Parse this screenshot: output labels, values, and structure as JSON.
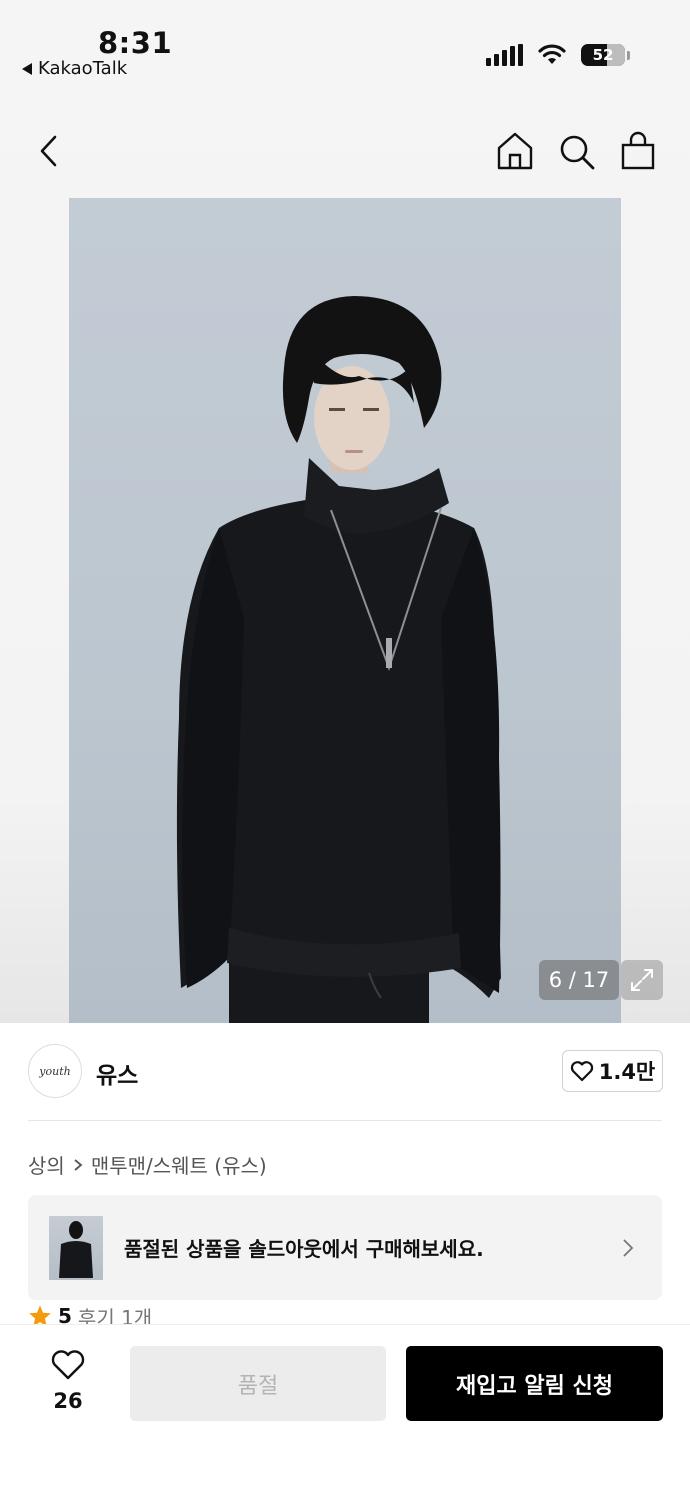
{
  "status_bar": {
    "time": "8:31",
    "back_app": "KakaoTalk",
    "battery": "52"
  },
  "nav": {
    "icons": [
      "back-icon",
      "home-icon",
      "search-icon",
      "shopping-bag-icon"
    ]
  },
  "gallery": {
    "counter": "6 / 17"
  },
  "brand": {
    "name": "유스",
    "logo_text": "youth",
    "likes": "1.4만"
  },
  "breadcrumb": {
    "category": "상의",
    "subcategory": "맨투맨/스웨트 (유스)"
  },
  "soldout_banner": {
    "text": "품절된 상품을 솔드아웃에서 구매해보세요."
  },
  "rating": {
    "score": "5",
    "reviews": "후기 1개"
  },
  "bottom_bar": {
    "wish_count": "26",
    "soldout_label": "품절",
    "restock_label": "재입고 알림 신청"
  },
  "colors": {
    "accent": "#000000",
    "star": "#f39b0c",
    "disabled_bg": "#ececec",
    "disabled_text": "#b4b4b4"
  }
}
